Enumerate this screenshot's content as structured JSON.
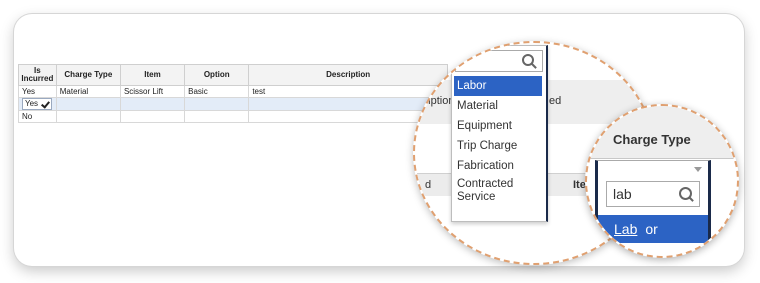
{
  "grid": {
    "headers": [
      "Is Incurred",
      "Charge Type",
      "Item",
      "Option",
      "Description"
    ],
    "rows": [
      [
        "Yes",
        "Material",
        "Scissor Lift",
        "Basic",
        "test"
      ],
      [
        "Yes",
        "",
        "",
        "",
        ""
      ],
      [
        "No",
        "",
        "",
        "",
        ""
      ]
    ]
  },
  "lens1": {
    "bg_left": "cription",
    "bg_right": "ed",
    "bg_bottom1": "d",
    "bg_bottom2": "Ite",
    "search_value": "",
    "options": [
      "Labor",
      "Material",
      "Equipment",
      "Trip Charge",
      "Fabrication",
      "Contracted Service"
    ],
    "highlighted": "Labor"
  },
  "lens2": {
    "header": "Charge Type",
    "search_value": "lab",
    "match_prefix": "Lab",
    "match_suffix": "or"
  },
  "colors": {
    "highlight": "#2c63c4",
    "lens_border": "#e0a070"
  }
}
